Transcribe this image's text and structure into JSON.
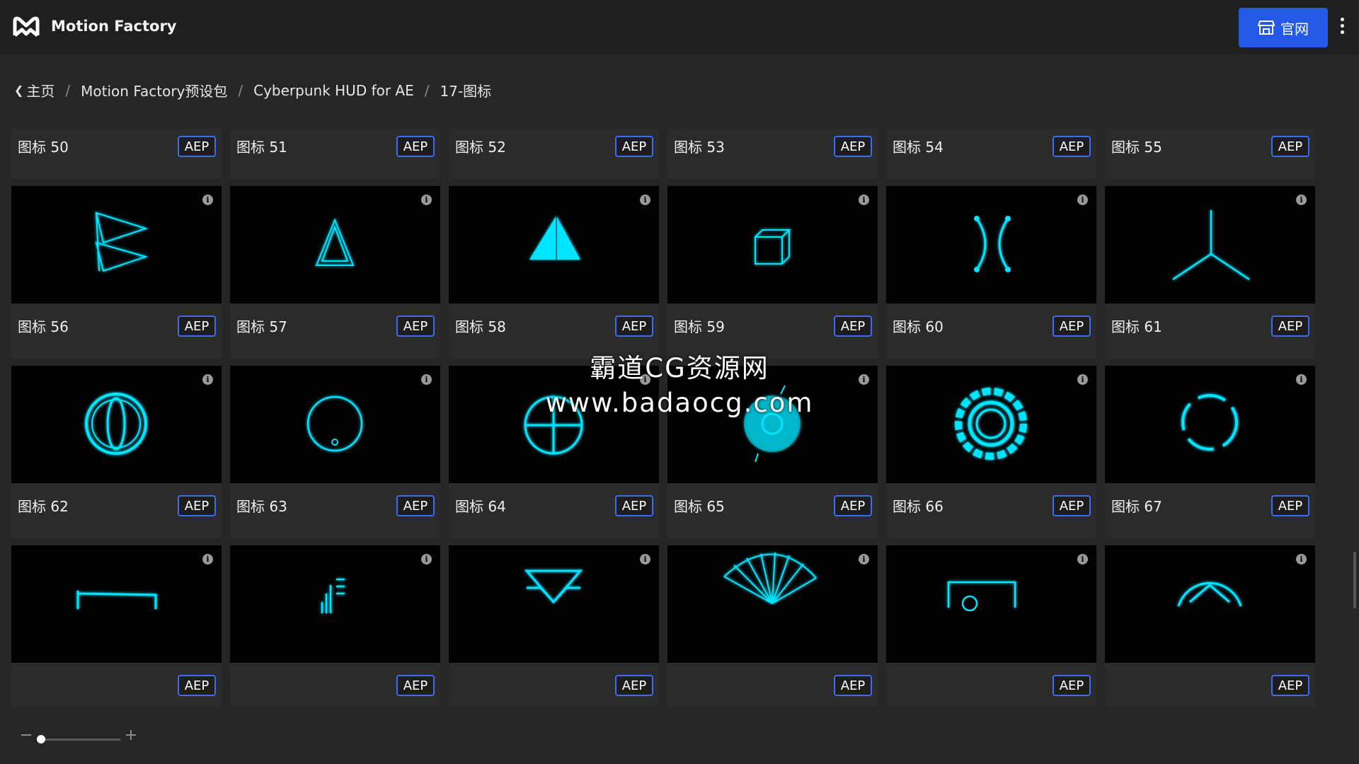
{
  "app": {
    "title": "Motion Factory"
  },
  "header": {
    "site_button_label": "官网"
  },
  "breadcrumb": [
    {
      "label": "主页"
    },
    {
      "label": "Motion Factory预设包"
    },
    {
      "label": "Cyberpunk HUD for AE"
    },
    {
      "label": "17-图标"
    }
  ],
  "accent_color": "#00e5ff",
  "button_color": "#2458e6",
  "badge_label": "AEP",
  "items": [
    {
      "title": "图标 50",
      "icon": "icosahedron-icon"
    },
    {
      "title": "图标 51",
      "icon": "play-triangle-icon"
    },
    {
      "title": "图标 52",
      "icon": "spiky-ring-icon"
    },
    {
      "title": "图标 53",
      "icon": "cube-wire-icon"
    },
    {
      "title": "图标 54",
      "icon": "cone-triangle-icon"
    },
    {
      "title": "图标 55",
      "icon": "cube-tilted-icon"
    },
    {
      "title": "图标 56",
      "icon": "prism-arrows-icon"
    },
    {
      "title": "图标 57",
      "icon": "triangle-outline-icon"
    },
    {
      "title": "图标 58",
      "icon": "pyramid-glow-icon"
    },
    {
      "title": "图标 59",
      "icon": "cube-small-icon"
    },
    {
      "title": "图标 60",
      "icon": "brackets-arcs-icon"
    },
    {
      "title": "图标 61",
      "icon": "tri-spoke-icon"
    },
    {
      "title": "图标 62",
      "icon": "orb-rings-icon"
    },
    {
      "title": "图标 63",
      "icon": "circle-stem-icon"
    },
    {
      "title": "图标 64",
      "icon": "circle-cross-icon"
    },
    {
      "title": "图标 65",
      "icon": "disc-dial-icon"
    },
    {
      "title": "图标 66",
      "icon": "gear-ring-icon"
    },
    {
      "title": "图标 67",
      "icon": "dashed-circle-icon"
    },
    {
      "title": "",
      "icon": "rect-frame-icon"
    },
    {
      "title": "",
      "icon": "bars-lines-icon"
    },
    {
      "title": "",
      "icon": "inverted-triangles-icon"
    },
    {
      "title": "",
      "icon": "fan-rays-icon"
    },
    {
      "title": "",
      "icon": "screen-frame-icon"
    },
    {
      "title": "",
      "icon": "arrow-circle-icon"
    }
  ],
  "watermark": {
    "line1": "霸道CG资源网",
    "line2": "www.badaocg.com"
  }
}
